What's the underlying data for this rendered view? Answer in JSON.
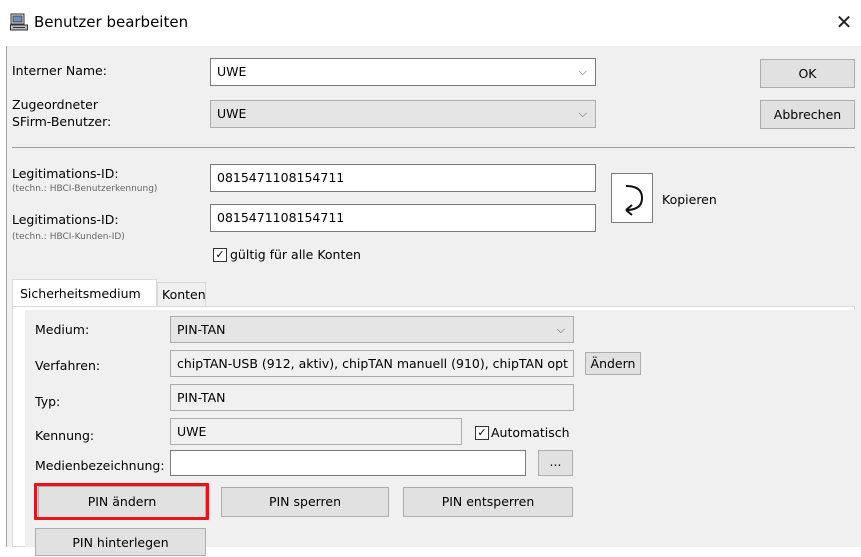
{
  "window": {
    "title": "Benutzer bearbeiten",
    "close": "✕"
  },
  "header": {
    "internal_name_label": "Interner Name:",
    "internal_name_value": "UWE",
    "assigned_user_label_1": "Zugeordneter",
    "assigned_user_label_2": "SFirm-Benutzer:",
    "assigned_user_value": "UWE",
    "ok_label": "OK",
    "cancel_label": "Abbrechen"
  },
  "legitimation": {
    "id1_label": "Legitimations-ID:",
    "id1_hint": "(techn.: HBCI-Benutzerkennung)",
    "id1_value": "0815471108154711",
    "id2_label": "Legitimations-ID:",
    "id2_hint": "(techn.: HBCI-Kunden-ID)",
    "id2_value": "0815471108154711",
    "copy_label": "Kopieren",
    "all_accounts_label": "gültig für alle Konten",
    "all_accounts_checked": true
  },
  "tabs": [
    {
      "label": "Sicherheitsmedium",
      "active": true
    },
    {
      "label": "Konten",
      "active": false
    }
  ],
  "security": {
    "medium_label": "Medium:",
    "medium_value": "PIN-TAN",
    "procedure_label": "Verfahren:",
    "procedure_value": "chipTAN-USB (912, aktiv), chipTAN manuell (910), chipTAN opt",
    "change_label": "Ändern",
    "type_label": "Typ:",
    "type_value": "PIN-TAN",
    "id_label": "Kennung:",
    "id_value": "UWE",
    "automatic_label": "Automatisch",
    "automatic_checked": true,
    "media_name_label": "Medienbezeichnung:",
    "media_name_value": "",
    "browse_label": "...",
    "pin_change": "PIN ändern",
    "pin_lock": "PIN sperren",
    "pin_unlock": "PIN entsperren",
    "pin_store": "PIN hinterlegen"
  },
  "colors": {
    "highlight": "#e8141b",
    "dialog_bg": "#f0f0f0"
  }
}
